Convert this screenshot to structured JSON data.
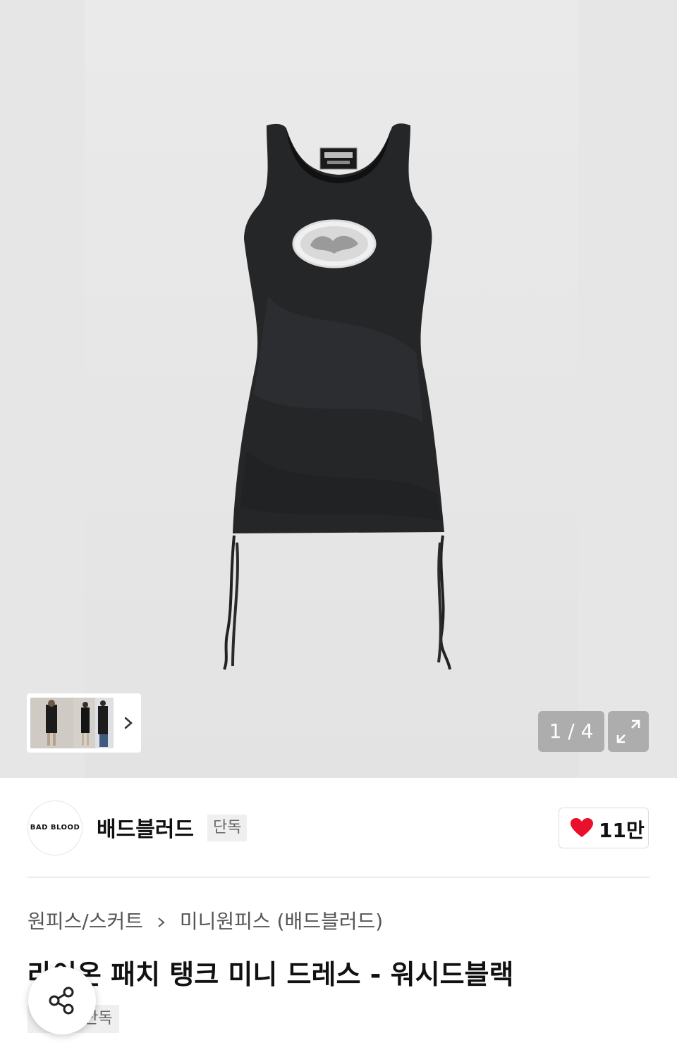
{
  "gallery": {
    "counter": "1 / 4",
    "product_image_alt": "product-photo-black-tank-dress"
  },
  "brand": {
    "logo_text": "BAD BLOOD",
    "name": "배드블러드",
    "badge": "단독"
  },
  "like": {
    "count": "11만"
  },
  "breadcrumb": {
    "level1": "원피스/스커트",
    "level2": "미니원피스 (배드블러드)"
  },
  "product": {
    "title": "라이온 패치 탱크 미니 드레스 - 워시드블랙",
    "badge": "단독"
  },
  "colors": {
    "heart": "#e8102a",
    "counter_bg": "#adadad",
    "hero_bg": "#e6e6e6"
  }
}
